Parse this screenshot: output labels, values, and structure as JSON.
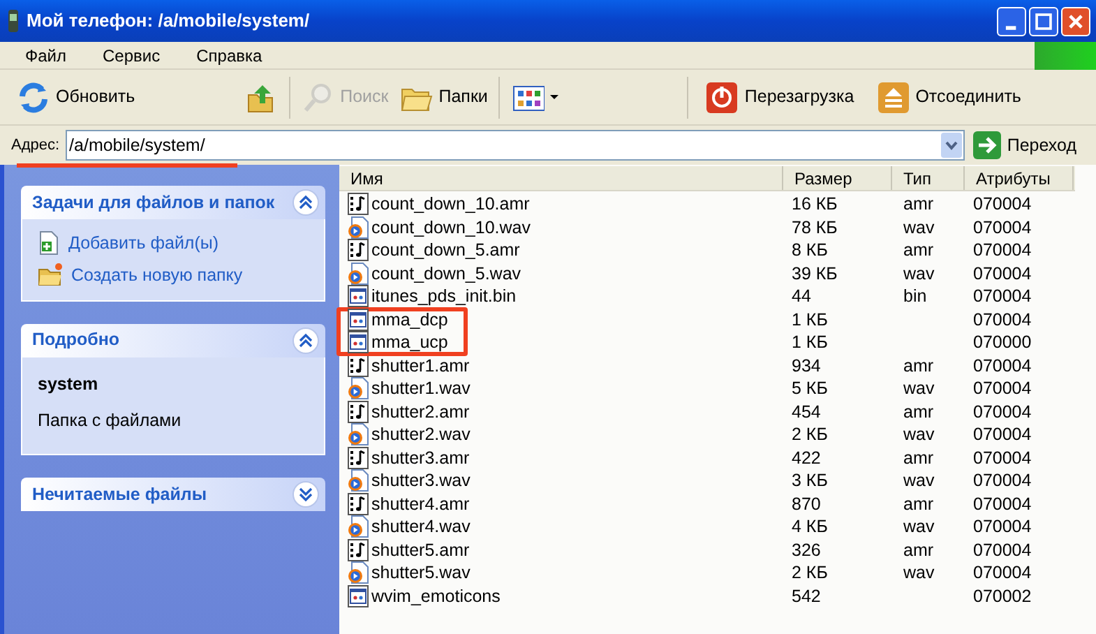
{
  "window": {
    "title": "Мой телефон: /a/mobile/system/"
  },
  "menu": [
    "Файл",
    "Сервис",
    "Справка"
  ],
  "toolbar": [
    {
      "kind": "refresh",
      "label": "Обновить",
      "disabled": false
    },
    {
      "kind": "up",
      "disabled": false
    },
    {
      "kind": "search",
      "label": "Поиск",
      "disabled": true
    },
    {
      "kind": "folders",
      "label": "Папки",
      "disabled": false
    },
    {
      "kind": "views",
      "disabled": false
    },
    {
      "kind": "reboot",
      "label": "Перезагрузка",
      "disabled": false
    },
    {
      "kind": "eject",
      "label": "Отсоединить",
      "disabled": false
    }
  ],
  "address": {
    "label": "Адрес:",
    "value": "/a/mobile/system/",
    "go": "Переход"
  },
  "sidebar": [
    {
      "title": "Задачи для файлов и папок",
      "expanded": true,
      "links": [
        {
          "kind": "add",
          "label": "Добавить файл(ы)"
        },
        {
          "kind": "folder",
          "label": "Создать новую папку"
        }
      ]
    },
    {
      "title": "Подробно",
      "expanded": true,
      "name": "system",
      "description": "Папка с файлами"
    },
    {
      "title": "Нечитаемые файлы",
      "expanded": false
    }
  ],
  "table": {
    "columns": [
      "Имя",
      "Размер",
      "Тип",
      "Атрибуты"
    ],
    "rows": [
      {
        "kind": "audio",
        "name": "count_down_10.amr",
        "size": "16 КБ",
        "type": "amr",
        "attributes": "070004",
        "highlighted": false
      },
      {
        "kind": "media",
        "name": "count_down_10.wav",
        "size": "78 КБ",
        "type": "wav",
        "attributes": "070004",
        "highlighted": false
      },
      {
        "kind": "audio",
        "name": "count_down_5.amr",
        "size": "8 КБ",
        "type": "amr",
        "attributes": "070004",
        "highlighted": false
      },
      {
        "kind": "media",
        "name": "count_down_5.wav",
        "size": "39 КБ",
        "type": "wav",
        "attributes": "070004",
        "highlighted": false
      },
      {
        "kind": "binary",
        "name": "itunes_pds_init.bin",
        "size": "44",
        "type": "bin",
        "attributes": "070004",
        "highlighted": false
      },
      {
        "kind": "binary",
        "name": "mma_dcp",
        "size": "1 КБ",
        "attributes": "070004",
        "highlighted": true
      },
      {
        "kind": "binary",
        "name": "mma_ucp",
        "size": "1 КБ",
        "attributes": "070000",
        "highlighted": true
      },
      {
        "kind": "audio",
        "name": "shutter1.amr",
        "size": "934",
        "type": "amr",
        "attributes": "070004",
        "highlighted": false
      },
      {
        "kind": "media",
        "name": "shutter1.wav",
        "size": "5 КБ",
        "type": "wav",
        "attributes": "070004",
        "highlighted": false
      },
      {
        "kind": "audio",
        "name": "shutter2.amr",
        "size": "454",
        "type": "amr",
        "attributes": "070004",
        "highlighted": false
      },
      {
        "kind": "media",
        "name": "shutter2.wav",
        "size": "2 КБ",
        "type": "wav",
        "attributes": "070004",
        "highlighted": false
      },
      {
        "kind": "audio",
        "name": "shutter3.amr",
        "size": "422",
        "type": "amr",
        "attributes": "070004",
        "highlighted": false
      },
      {
        "kind": "media",
        "name": "shutter3.wav",
        "size": "3 КБ",
        "type": "wav",
        "attributes": "070004",
        "highlighted": false
      },
      {
        "kind": "audio",
        "name": "shutter4.amr",
        "size": "870",
        "type": "amr",
        "attributes": "070004",
        "highlighted": false
      },
      {
        "kind": "media",
        "name": "shutter4.wav",
        "size": "4 КБ",
        "type": "wav",
        "attributes": "070004",
        "highlighted": false
      },
      {
        "kind": "audio",
        "name": "shutter5.amr",
        "size": "326",
        "type": "amr",
        "attributes": "070004",
        "highlighted": false
      },
      {
        "kind": "media",
        "name": "shutter5.wav",
        "size": "2 КБ",
        "type": "wav",
        "attributes": "070004",
        "highlighted": false
      },
      {
        "kind": "binary",
        "name": "wvim_emoticons",
        "size": "542",
        "attributes": "070002",
        "highlighted": false
      }
    ]
  }
}
